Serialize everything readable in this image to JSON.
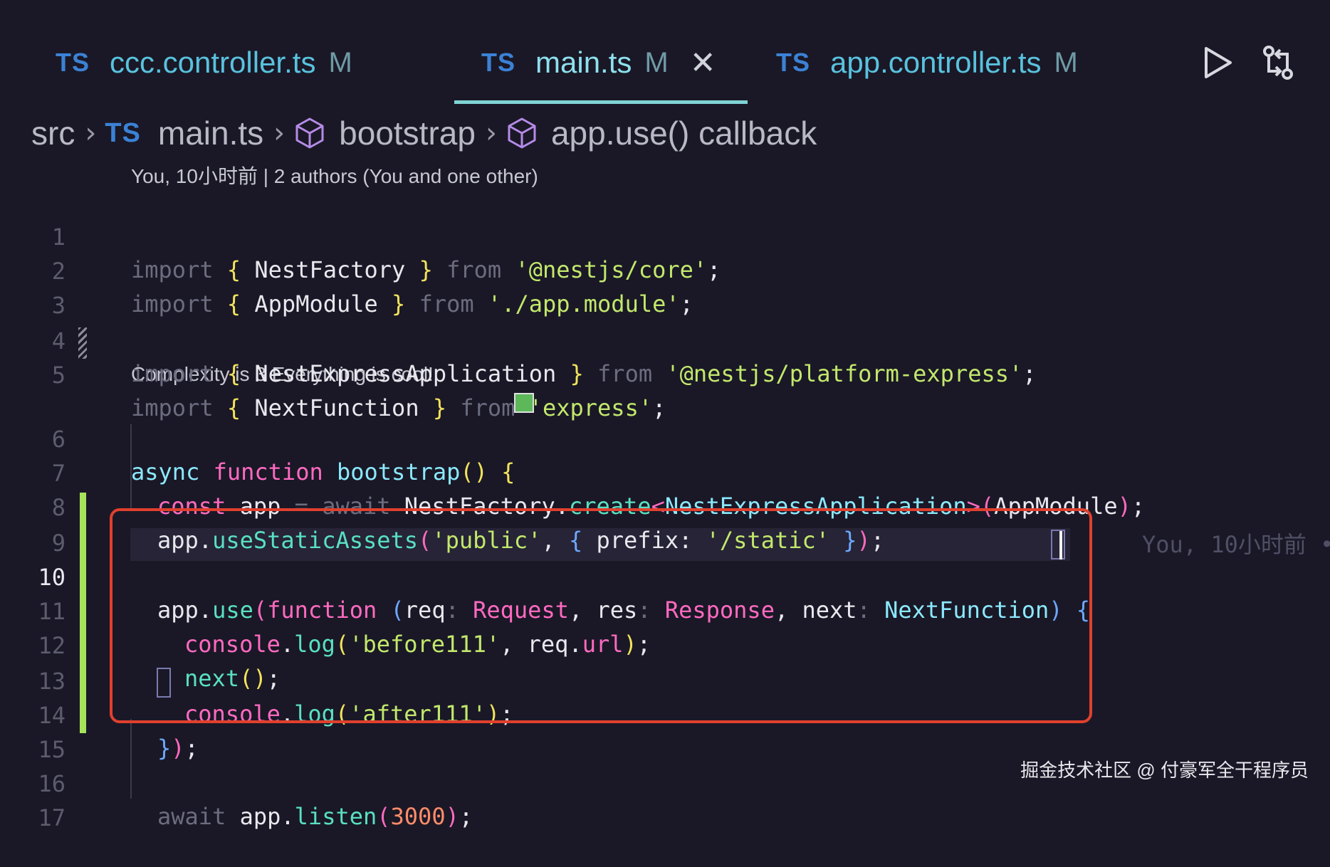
{
  "tabs": [
    {
      "lang": "TS",
      "name": "ccc.controller.ts",
      "status": "M"
    },
    {
      "lang": "TS",
      "name": "main.ts",
      "status": "M",
      "active": true
    },
    {
      "lang": "TS",
      "name": "app.controller.ts",
      "status": "M"
    }
  ],
  "toolbar": {
    "run_icon": "play-icon",
    "compare_icon": "git-compare-icon"
  },
  "breadcrumb": {
    "folder": "src",
    "file_lang": "TS",
    "file": "main.ts",
    "symbol1": "bootstrap",
    "symbol2": "app.use() callback"
  },
  "codelens": {
    "blame": "You, 10小时前 | 2 authors (You and one other)",
    "complexity": "Complexity is 3 Everything is cool!"
  },
  "inline_blame": "You, 10小时前 •",
  "line_numbers": [
    "1",
    "2",
    "3",
    "4",
    "5",
    "6",
    "7",
    "8",
    "9",
    "10",
    "11",
    "12",
    "13",
    "14",
    "15",
    "16",
    "17"
  ],
  "current_line": "10",
  "code": {
    "l1": {
      "a": "import",
      "b": " { ",
      "c": "NestFactory",
      "d": " } ",
      "e": "from",
      "f": " '@nestjs/core'",
      "g": ";"
    },
    "l2": {
      "a": "import",
      "b": " { ",
      "c": "AppModule",
      "d": " } ",
      "e": "from",
      "f": " './app.module'",
      "g": ";"
    },
    "l4": {
      "a": "import",
      "b": " { ",
      "c": "NestExpressApplication",
      "d": " } ",
      "e": "from",
      "f": " '@nestjs/platform-express'",
      "g": ";"
    },
    "l5": {
      "a": "import",
      "b": " { ",
      "c": "NextFunction",
      "d": " } ",
      "e": "from",
      "f": " 'express'",
      "g": ";"
    },
    "l6": {
      "a": "async",
      "b": " function",
      "c": " bootstrap",
      "d": "()",
      "e": " {"
    },
    "l7": {
      "a": "const",
      "b": " app",
      "c": " =",
      "d": " await",
      "e": " NestFactory",
      "f": ".",
      "g": "create",
      "h": "<",
      "i": "NestExpressApplication",
      "j": ">",
      "k": "(",
      "l": "AppModule",
      "m": ")",
      "n": ";"
    },
    "l8": {
      "a": "app",
      "b": ".",
      "c": "useStaticAssets",
      "d": "(",
      "e": "'public'",
      "f": ", ",
      "g": "{",
      "h": " prefix: ",
      "i": "'/static'",
      "j": " }",
      "k": ")",
      "l": ";"
    },
    "l10": {
      "a": "app",
      "b": ".",
      "c": "use",
      "d": "(",
      "e": "function",
      "f": " (",
      "g": "req",
      "h": ":",
      "i": " Request",
      "j": ", ",
      "k": "res",
      "l": ":",
      "m": " Response",
      "n": ", ",
      "o": "next",
      "p": ":",
      "q": " NextFunction",
      "r": ")",
      "s": " {"
    },
    "l11": {
      "a": "console",
      "b": ".",
      "c": "log",
      "d": "(",
      "e": "'before111'",
      "f": ", ",
      "g": "req",
      "h": ".",
      "i": "url",
      "j": ")",
      "k": ";"
    },
    "l12": {
      "a": "next",
      "b": "()",
      "c": ";"
    },
    "l13": {
      "a": "console",
      "b": ".",
      "c": "log",
      "d": "(",
      "e": "'after111'",
      "f": ")",
      "g": ";"
    },
    "l14": {
      "a": "}",
      "b": ")",
      "c": ";"
    },
    "l16": {
      "a": "await",
      "b": " app",
      "c": ".",
      "d": "listen",
      "e": "(",
      "f": "3000",
      "g": ")",
      "h": ";"
    }
  },
  "watermark": "掘金技术社区 @ 付豪军全干程序员",
  "colors": {
    "background": "#1a1826",
    "accent": "#7fd3d3",
    "git_added": "#a6e35a",
    "highlight_box": "#e0402e"
  }
}
